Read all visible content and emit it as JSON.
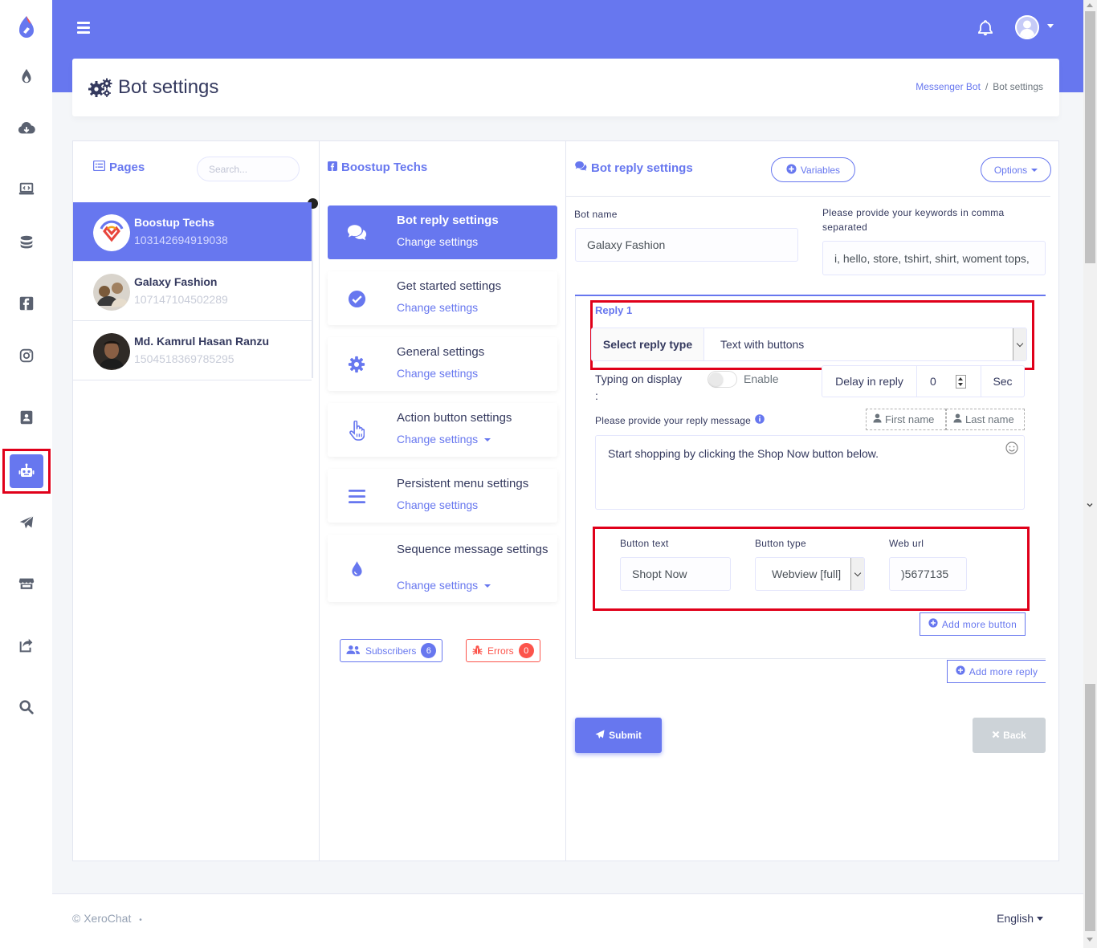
{
  "colors": {
    "primary": "#6777ef",
    "danger": "#fc544b",
    "highlight": "#e0001a"
  },
  "sidebar": {
    "icons": [
      "app-logo-icon",
      "fire-icon",
      "cloud-download-icon",
      "laptop-code-icon",
      "coins-icon",
      "facebook-square-icon",
      "instagram-icon",
      "address-book-icon",
      "robot-icon",
      "paper-plane-icon",
      "store-icon",
      "share-square-icon",
      "search-icon"
    ],
    "active": "robot-icon"
  },
  "header": {
    "title": "Bot settings",
    "breadcrumb": [
      "Messenger Bot",
      "Bot settings"
    ],
    "separator": "/"
  },
  "pages": {
    "heading": "Pages",
    "search_placeholder": "Search...",
    "items": [
      {
        "name": "Boostup Techs",
        "id": "103142694919038",
        "active": true
      },
      {
        "name": "Galaxy Fashion",
        "id": "107147104502289",
        "active": false
      },
      {
        "name": "Md. Kamrul Hasan Ranzu",
        "id": "1504518369785295",
        "active": false
      }
    ]
  },
  "menu": {
    "heading": "Boostup Techs",
    "items": [
      {
        "title": "Bot reply settings",
        "sub": "Change settings",
        "icon": "comments-icon",
        "active": true
      },
      {
        "title": "Get started settings",
        "sub": "Change settings",
        "icon": "check-circle-icon"
      },
      {
        "title": "General settings",
        "sub": "Change settings",
        "icon": "cog-icon"
      },
      {
        "title": "Action button settings",
        "sub": "Change settings",
        "icon": "hand-pointer-icon",
        "caret": true
      },
      {
        "title": "Persistent menu settings",
        "sub": "Change settings",
        "icon": "bars-icon"
      },
      {
        "title": "Sequence message settings",
        "sub": "Change settings",
        "icon": "tint-icon",
        "caret": true
      }
    ],
    "subscribers_label": "Subscribers",
    "subscribers_count": "6",
    "errors_label": "Errors",
    "errors_count": "0"
  },
  "reply_settings": {
    "heading": "Bot reply settings",
    "variables_label": "Variables",
    "options_label": "Options",
    "bot_name_label": "Bot name",
    "bot_name_value": "Galaxy Fashion",
    "keywords_label": "Please provide your keywords in comma separated",
    "keywords_value": "i, hello, store, tshirt, shirt, woment tops,",
    "reply_title": "Reply 1",
    "select_reply_type_label": "Select reply type",
    "select_reply_type_value": "Text with buttons",
    "typing_label": "Typing on display",
    "typing_colon": ":",
    "enable_label": "Enable",
    "delay_label": "Delay in reply",
    "delay_value": "0",
    "delay_unit": "Sec",
    "message_label": "Please provide your reply message",
    "first_name_label": "First name",
    "last_name_label": "Last name",
    "message_value": "Start shopping by clicking the Shop Now button below.",
    "button_text_label": "Button text",
    "button_text_value": "Shopt Now",
    "button_type_label": "Button type",
    "button_type_value": "Webview [full]",
    "web_url_label": "Web url",
    "web_url_value": ")5677135",
    "add_more_button_label": "Add more button",
    "add_more_reply_label": "Add more reply",
    "submit_label": "Submit",
    "back_label": "Back"
  },
  "footer": {
    "copyright": "© XeroChat",
    "bullet": "•",
    "language": "English"
  }
}
